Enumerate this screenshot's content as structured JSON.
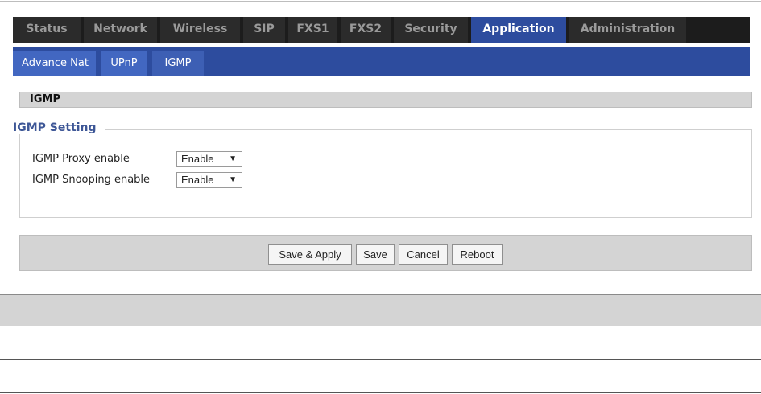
{
  "main_tabs": [
    {
      "label": "Status"
    },
    {
      "label": "Network"
    },
    {
      "label": "Wireless"
    },
    {
      "label": "SIP"
    },
    {
      "label": "FXS1"
    },
    {
      "label": "FXS2"
    },
    {
      "label": "Security"
    },
    {
      "label": "Application",
      "active": true
    },
    {
      "label": "Administration"
    }
  ],
  "sub_tabs": [
    {
      "label": "Advance Nat"
    },
    {
      "label": "UPnP"
    },
    {
      "label": "IGMP",
      "active": true
    }
  ],
  "section": {
    "title": "IGMP"
  },
  "igmp_setting": {
    "legend": "IGMP Setting",
    "proxy": {
      "label": "IGMP Proxy enable",
      "value": "Enable"
    },
    "snooping": {
      "label": "IGMP Snooping enable",
      "value": "Enable"
    },
    "dropdown_icon": "triangle-down-icon"
  },
  "buttons": {
    "save_apply": "Save & Apply",
    "save": "Save",
    "cancel": "Cancel",
    "reboot": "Reboot"
  },
  "colors": {
    "tab_bar": "#1c1c1c",
    "tab_active": "#2d4c9e",
    "sub_tab": "#4267c1",
    "legend_text": "#3d5696",
    "panel_gray": "#d4d4d4"
  }
}
